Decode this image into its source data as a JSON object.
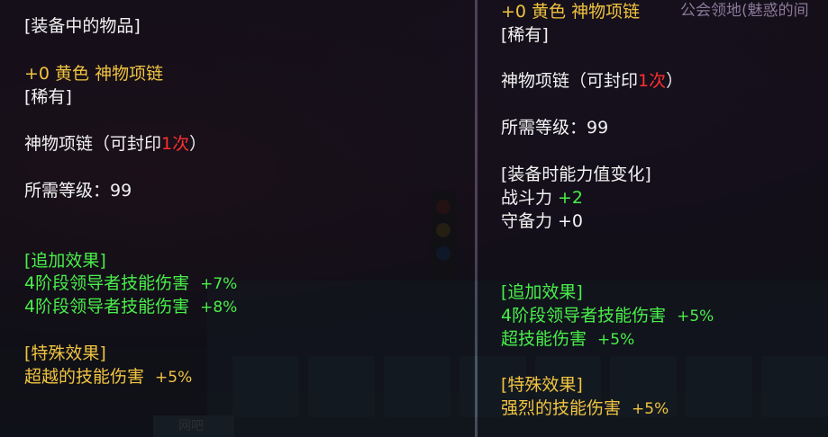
{
  "left_tooltip": {
    "header": "[装备中的物品]",
    "grade_line": "+0 黄色 神物项链",
    "rarity": "[稀有]",
    "seal_prefix": "神物项链（可封印",
    "seal_count": "1次",
    "seal_suffix": "）",
    "level": "所需等级：99",
    "extra_header": "[追加效果]",
    "extra_effects": [
      {
        "name": "4阶段领导者技能伤害",
        "value": "+7%"
      },
      {
        "name": "4阶段领导者技能伤害",
        "value": "+8%"
      }
    ],
    "special_header": "[特殊效果]",
    "special_effects": [
      {
        "name": "超越的技能伤害",
        "value": "+5%"
      }
    ]
  },
  "right_tooltip": {
    "grade_line": "+0 黄色 神物项链",
    "background_text": "公会领地(魅惑的间",
    "rarity": "[稀有]",
    "seal_prefix": "神物项链（可封印",
    "seal_count": "1次",
    "seal_suffix": "）",
    "level": "所需等级：99",
    "change_header": "[装备时能力值变化]",
    "changes": [
      {
        "name": "战斗力",
        "value": "+2"
      },
      {
        "name": "守备力",
        "value": "+0"
      }
    ],
    "extra_header": "[追加效果]",
    "extra_effects": [
      {
        "name": "4阶段领导者技能伤害",
        "value": "+5%"
      },
      {
        "name": "超技能伤害",
        "value": "+5%"
      }
    ],
    "special_header": "[特殊效果]",
    "special_effects": [
      {
        "name": "强烈的技能伤害",
        "value": "+5%"
      }
    ]
  },
  "background": {
    "bottom_tag": "网吧"
  },
  "colors": {
    "gold": "#f0c341",
    "green": "#49ee4a",
    "red": "#ff2f2f",
    "white": "#f2f2f2"
  }
}
